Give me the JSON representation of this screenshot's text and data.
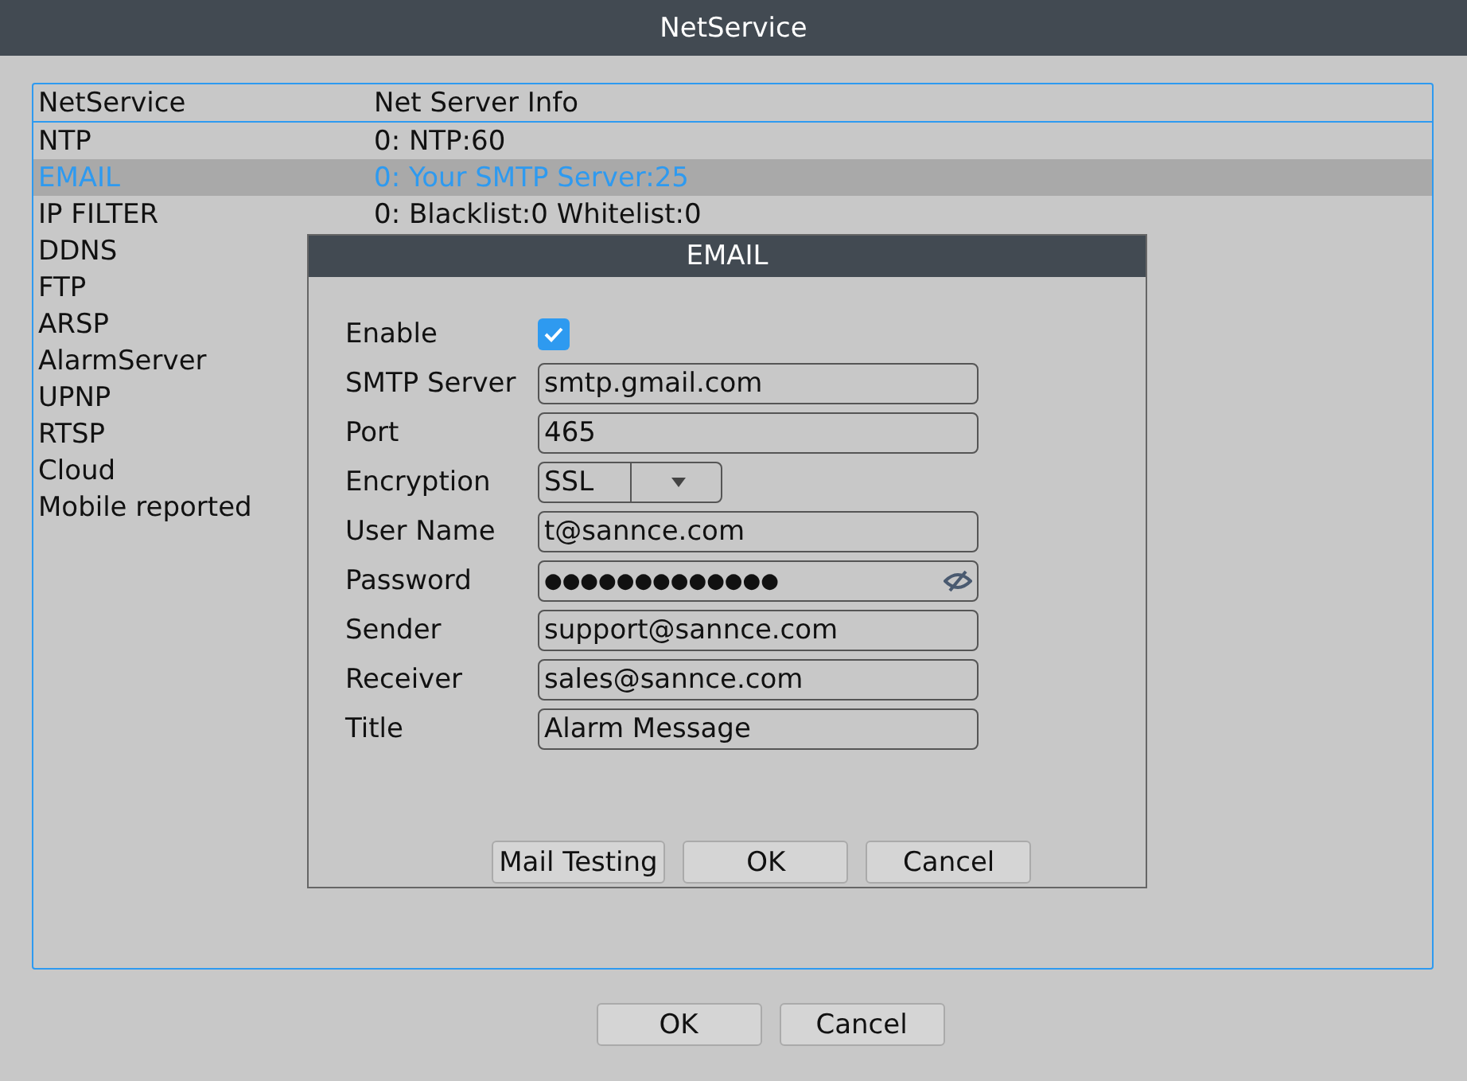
{
  "window": {
    "title": "NetService"
  },
  "table": {
    "columns": [
      "NetService",
      "Net Server Info"
    ],
    "rows": [
      {
        "service": "NTP",
        "info": "0: NTP:60",
        "selected": false
      },
      {
        "service": "EMAIL",
        "info": "0: Your SMTP Server:25",
        "selected": true
      },
      {
        "service": "IP FILTER",
        "info": "0: Blacklist:0 Whitelist:0",
        "selected": false
      },
      {
        "service": "DDNS",
        "selected": false
      },
      {
        "service": "FTP",
        "selected": false
      },
      {
        "service": "ARSP",
        "selected": false
      },
      {
        "service": "AlarmServer",
        "selected": false
      },
      {
        "service": "UPNP",
        "selected": false
      },
      {
        "service": "RTSP",
        "selected": false
      },
      {
        "service": "Cloud",
        "selected": false
      },
      {
        "service": "Mobile reported",
        "selected": false
      }
    ]
  },
  "dialog": {
    "title": "EMAIL",
    "fields": [
      {
        "kind": "checkbox",
        "label": "Enable",
        "checked": true
      },
      {
        "kind": "text",
        "label": "SMTP Server",
        "value": "smtp.gmail.com"
      },
      {
        "kind": "text",
        "label": "Port",
        "value": "465"
      },
      {
        "kind": "select",
        "label": "Encryption",
        "value": "SSL"
      },
      {
        "kind": "text",
        "label": "User Name",
        "value": "t@sannce.com"
      },
      {
        "kind": "password",
        "label": "Password",
        "value": "●●●●●●●●●●●●●"
      },
      {
        "kind": "text",
        "label": "Sender",
        "value": "support@sannce.com"
      },
      {
        "kind": "text",
        "label": "Receiver",
        "value": "sales@sannce.com"
      },
      {
        "kind": "text",
        "label": "Title",
        "value": "Alarm Message"
      }
    ],
    "buttons": [
      "Mail Testing",
      "OK",
      "Cancel"
    ]
  },
  "buttons": [
    "OK",
    "Cancel"
  ]
}
